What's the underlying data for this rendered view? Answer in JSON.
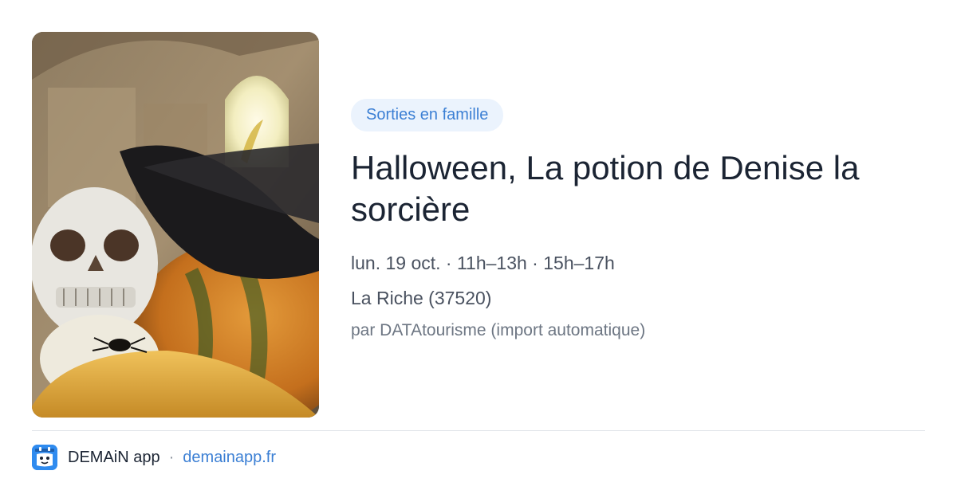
{
  "event": {
    "category": "Sorties en famille",
    "title": "Halloween, La potion de Denise la sorcière",
    "schedule": "lun. 19 oct. · 11h–13h · 15h–17h",
    "location": "La Riche (37520)",
    "source": "par DATAtourisme (import automatique)",
    "image_subject": "halloween-skull-pumpkin-witch-hat-photo"
  },
  "footer": {
    "app_name": "DEMAiN app",
    "separator": "·",
    "link": "demainapp.fr",
    "logo_icon": "demain-app-logo-icon"
  },
  "colors": {
    "accent": "#3b7fd4",
    "badge_bg": "#ebf3fd",
    "title": "#1b2433",
    "muted": "#4a5260",
    "logo_bg": "#2f8bef"
  }
}
